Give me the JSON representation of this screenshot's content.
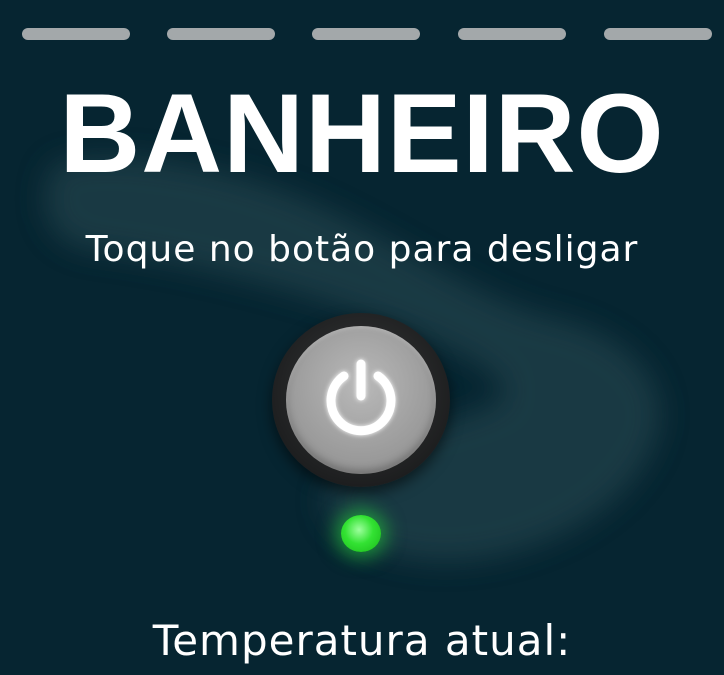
{
  "header": {
    "tabs": [
      {
        "name": "tab-1"
      },
      {
        "name": "tab-2"
      },
      {
        "name": "tab-3"
      },
      {
        "name": "tab-4"
      },
      {
        "name": "tab-5"
      }
    ]
  },
  "room": {
    "title": "BANHEIRO",
    "instruction": "Toque no botão para desligar"
  },
  "controls": {
    "power_icon": "power-icon",
    "status_led_color": "#33e233",
    "status": "on"
  },
  "temperature": {
    "label": "Temperatura atual:"
  },
  "colors": {
    "background": "#062531",
    "tab": "#a3a8aa",
    "text": "#ffffff",
    "led_on": "#33e233"
  }
}
